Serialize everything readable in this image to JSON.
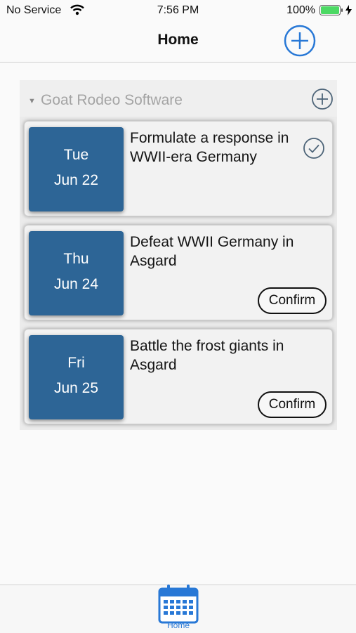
{
  "status_bar": {
    "carrier": "No Service",
    "time": "7:56 PM",
    "battery": "100%"
  },
  "nav": {
    "title": "Home",
    "add_icon": "plus-circle-icon"
  },
  "section": {
    "title": "Goat Rodeo Software",
    "items": [
      {
        "day": "Tue",
        "date": "Jun 22",
        "title": "Formulate a response in WWII-era Germany",
        "status": "done"
      },
      {
        "day": "Thu",
        "date": "Jun 24",
        "title": "Defeat WWII Germany in Asgard",
        "action": "Confirm"
      },
      {
        "day": "Fri",
        "date": "Jun 25",
        "title": "Battle the frost giants in Asgard",
        "action": "Confirm"
      }
    ]
  },
  "tab_bar": {
    "home_label": "Home",
    "home_icon": "calendar-icon"
  },
  "colors": {
    "accent": "#2878d6",
    "tile": "#2d6596",
    "battery": "#4cd964"
  }
}
